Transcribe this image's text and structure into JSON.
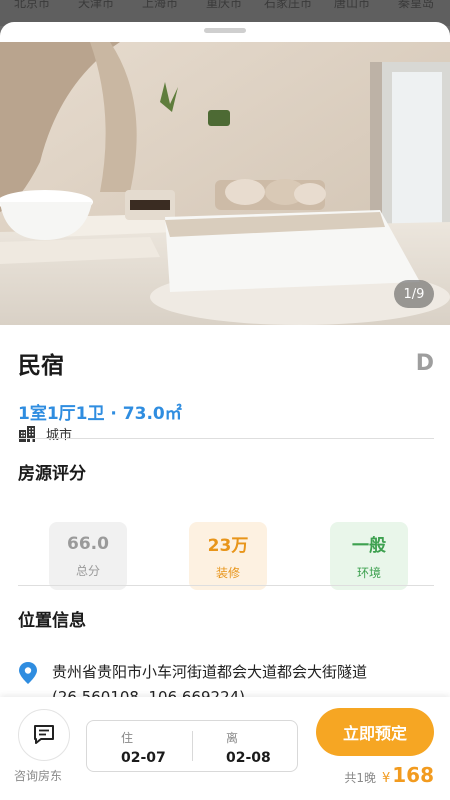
{
  "city_bar": [
    "北京市",
    "天津市",
    "上海市",
    "重庆市",
    "石家庄市",
    "唐山市",
    "秦皇岛"
  ],
  "photo": {
    "counter": "1/9",
    "description_icon": "room-photo"
  },
  "listing": {
    "title": "民宿",
    "grade": "D",
    "layout": "1室1厅1卫 · 73.0㎡",
    "area_type": "城市"
  },
  "rating": {
    "section_title": "房源评分",
    "cards": [
      {
        "value": "66.0",
        "label": "总分",
        "bg": "#f1f1f1",
        "color": "#9a9a9a"
      },
      {
        "value": "23万",
        "label": "装修",
        "bg": "#fdf1e1",
        "color": "#e8951a"
      },
      {
        "value": "一般",
        "label": "环境",
        "bg": "#e9f6ea",
        "color": "#3ea150"
      }
    ]
  },
  "location": {
    "section_title": "位置信息",
    "address": "贵州省贵阳市小车河街道都会大道都会大街隧道",
    "coords": "(26.560108, 106.669224)"
  },
  "bottom_bar": {
    "consult_label": "咨询房东",
    "checkin_label": "住",
    "checkin_date": "02-07",
    "checkout_label": "离",
    "checkout_date": "02-08",
    "book_label": "立即预定",
    "nights": "共1晚",
    "currency": "¥",
    "price": "168"
  },
  "colors": {
    "accent_blue": "#2f8de0",
    "accent_orange": "#f6a623"
  }
}
